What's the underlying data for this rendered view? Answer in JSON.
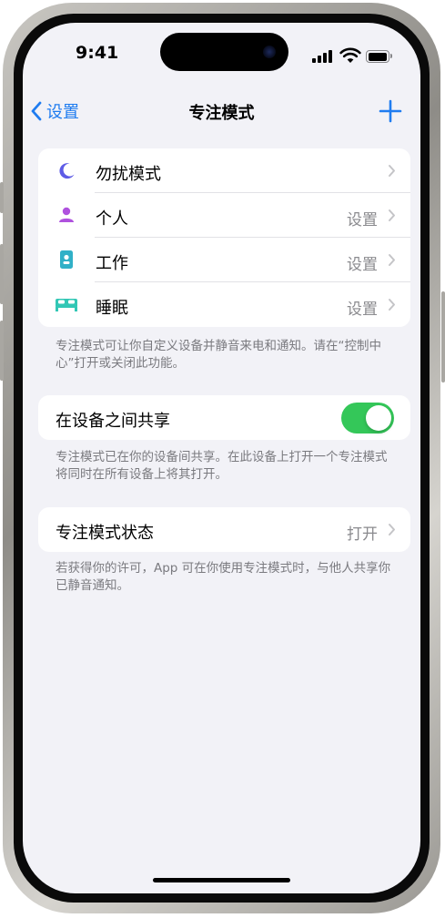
{
  "status_bar": {
    "time": "9:41"
  },
  "nav": {
    "back_label": "设置",
    "title": "专注模式"
  },
  "focus_modes": [
    {
      "label": "勿扰模式",
      "value": "",
      "icon": "moon-icon",
      "color": "#5e5ce6"
    },
    {
      "label": "个人",
      "value": "设置",
      "icon": "person-icon",
      "color": "#af52de"
    },
    {
      "label": "工作",
      "value": "设置",
      "icon": "id-badge-icon",
      "color": "#30b0c7"
    },
    {
      "label": "睡眠",
      "value": "设置",
      "icon": "bed-icon",
      "color": "#32c7b5"
    }
  ],
  "focus_footnote": "专注模式可让你自定义设备并静音来电和通知。请在“控制中心”打开或关闭此功能。",
  "share": {
    "label": "在设备之间共享",
    "enabled": true,
    "accent": "#34c759"
  },
  "share_footnote": "专注模式已在你的设备间共享。在此设备上打开一个专注模式将同时在所有设备上将其打开。",
  "status": {
    "label": "专注模式状态",
    "value": "打开"
  },
  "status_footnote": "若获得你的许可，App 可在你使用专注模式时，与他人共享你已静音通知。",
  "colors": {
    "link": "#1f7cf0",
    "background": "#f2f2f7"
  }
}
